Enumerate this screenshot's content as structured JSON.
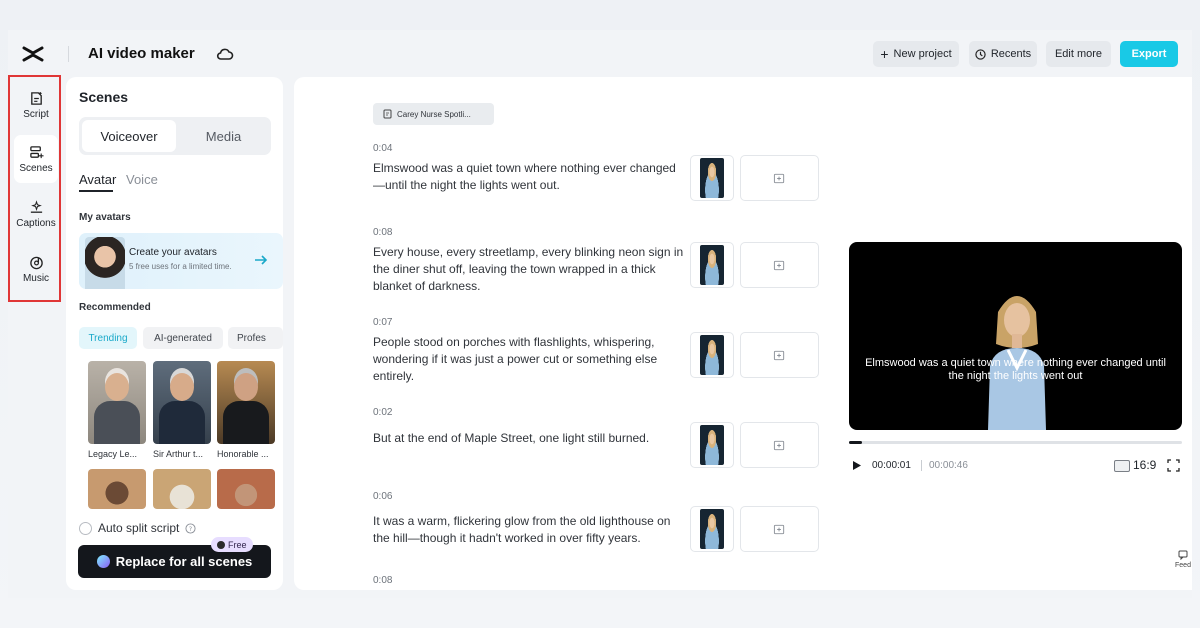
{
  "header": {
    "app_title": "AI video maker",
    "new_project": "New project",
    "recents": "Recents",
    "edit_more": "Edit more",
    "export": "Export"
  },
  "leftnav": {
    "items": [
      {
        "label": "Script",
        "icon": "script-icon"
      },
      {
        "label": "Scenes",
        "icon": "scenes-icon"
      },
      {
        "label": "Captions",
        "icon": "captions-icon"
      },
      {
        "label": "Music",
        "icon": "music-icon"
      }
    ],
    "active": "Scenes"
  },
  "panel": {
    "title": "Scenes",
    "segments": [
      "Voiceover",
      "Media"
    ],
    "subtabs": [
      "Avatar",
      "Voice"
    ],
    "my_avatars_label": "My avatars",
    "create_title": "Create your avatars",
    "create_sub": "5 free uses for a limited time.",
    "recommended_label": "Recommended",
    "chips": [
      "Trending",
      "AI-generated",
      "Profes"
    ],
    "avatars": [
      {
        "name": "Legacy Le..."
      },
      {
        "name": "Sir Arthur t..."
      },
      {
        "name": "Honorable ..."
      }
    ],
    "auto_split": "Auto split script",
    "replace_button": "Replace for all scenes",
    "free_badge": "Free"
  },
  "main": {
    "file_name": "Carey Nurse Spotli...",
    "scenes": [
      {
        "time": "0:04",
        "text": "Elmswood was a quiet town where nothing ever changed—until the night the lights went out."
      },
      {
        "time": "0:08",
        "text": "Every house, every streetlamp, every blinking neon sign in the diner shut off, leaving the town wrapped in a thick blanket of darkness."
      },
      {
        "time": "0:07",
        "text": "People stood on porches with flashlights, whispering, wondering if it was just a power cut or something else entirely."
      },
      {
        "time": "0:02",
        "text": "But at the end of Maple Street, one light still burned."
      },
      {
        "time": "0:06",
        "text": "It was a warm, flickering glow from the old lighthouse on the hill—though it hadn't worked in over fifty years."
      },
      {
        "time": "0:08",
        "text": ""
      }
    ]
  },
  "preview": {
    "caption": "Elmswood was a quiet town where nothing ever changed until the night the lights went out",
    "current_time": "00:00:01",
    "total_time": "00:00:46",
    "progress_fraction": 0.04,
    "ratio": "16:9"
  },
  "feedback_label": "Feed",
  "colors": {
    "accent": "#19c9e6",
    "highlight_border": "#e03636"
  }
}
